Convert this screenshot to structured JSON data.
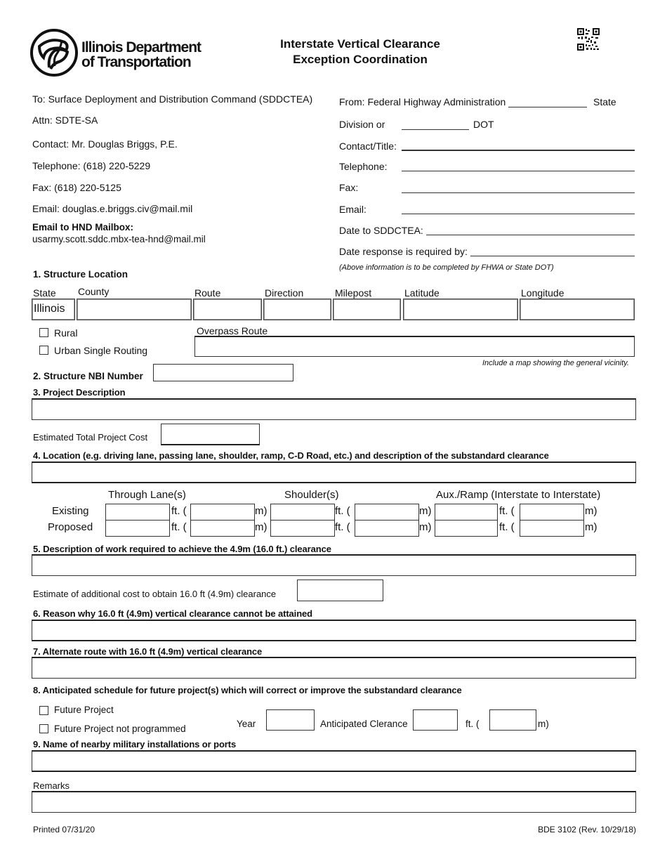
{
  "header": {
    "logo_line1": "Illinois Department",
    "logo_line2": "of Transportation",
    "title_line1": "Interstate Vertical Clearance",
    "title_line2": "Exception Coordination",
    "logo_icon": "idot-trefoil-logo-icon",
    "qr_icon": "qr-code-icon"
  },
  "to": {
    "to": "To: Surface Deployment and Distribution Command (SDDCTEA)",
    "attn": "Attn: SDTE-SA",
    "contact": "Contact: Mr. Douglas Briggs, P.E.",
    "telephone": "Telephone: (618) 220-5229",
    "fax": "Fax: (618) 220-5125",
    "email": "Email: douglas.e.briggs.civ@mail.mil",
    "mailbox_label": "Email to HND Mailbox:",
    "mailbox_value": "usarmy.scott.sddc.mbx-tea-hnd@mail.mil"
  },
  "from": {
    "from_label": "From: Federal Highway Administration",
    "state_label": "State",
    "division_label": "Division or",
    "dot_label": "DOT",
    "contact_label": "Contact/Title:",
    "telephone_label": "Telephone:",
    "fax_label": "Fax:",
    "email_label": "Email:",
    "date_to_label": "Date to SDDCTEA:",
    "date_response_label": "Date response is required by:",
    "note": "(Above information is to be completed by FHWA or State DOT)",
    "values": {
      "state": "",
      "division": "",
      "contact": "",
      "telephone": "",
      "fax": "",
      "email": "",
      "date_to": "",
      "date_response": ""
    }
  },
  "section1": {
    "title": "1.  Structure Location",
    "columns": [
      "State",
      "County",
      "Route",
      "Direction",
      "Milepost",
      "Latitude",
      "Longitude"
    ],
    "values": {
      "state": "Illinois",
      "county": "",
      "route": "",
      "direction": "",
      "milepost": "",
      "latitude": "",
      "longitude": ""
    },
    "rural_label": "Rural",
    "rural_checked": false,
    "urban_label": "Urban Single Routing",
    "urban_checked": false,
    "overpass_label": "Overpass Route",
    "overpass_value": "",
    "map_note": "Include a map showing the general vicinity."
  },
  "section2": {
    "title": "2.  Structure NBI Number",
    "value": ""
  },
  "section3": {
    "title": "3.  Project Description",
    "value": "",
    "cost_label": "Estimated Total Project Cost",
    "cost_value": ""
  },
  "section4": {
    "title": "4.  Location (e.g. driving lane, passing lane, shoulder, ramp, C-D Road, etc.) and description of the substandard clearance",
    "value": "",
    "groups": [
      "Through Lane(s)",
      "Shoulder(s)",
      "Aux./Ramp (Interstate to Interstate)"
    ],
    "rows": [
      "Existing",
      "Proposed"
    ],
    "ft_label": "ft. (",
    "m_label": "m)"
  },
  "section5": {
    "title": "5.  Description of work required to achieve the 4.9m (16.0 ft.) clearance",
    "value": "",
    "estimate_label": "Estimate of additional cost to obtain 16.0 ft (4.9m) clearance",
    "estimate_value": ""
  },
  "section6": {
    "title": "6.  Reason why 16.0 ft (4.9m) vertical clearance cannot be attained",
    "value": ""
  },
  "section7": {
    "title": "7.  Alternate route with 16.0 ft (4.9m) vertical clearance",
    "value": ""
  },
  "section8": {
    "title": "8.  Anticipated schedule for future project(s) which will correct or improve the substandard clearance",
    "future_label": "Future Project",
    "future_checked": false,
    "not_programmed_label": "Future Project not programmed",
    "not_programmed_checked": false,
    "year_label": "Year",
    "clearance_label": "Anticipated Clerance",
    "ft_label": "ft. (",
    "m_label": "m)"
  },
  "section9": {
    "title": "9.  Name of nearby military installations or ports",
    "value": ""
  },
  "remarks": {
    "label": "Remarks",
    "value": ""
  },
  "footer": {
    "printed": "Printed 07/31/20",
    "form_id": "BDE 3102 (Rev. 10/29/18)"
  }
}
